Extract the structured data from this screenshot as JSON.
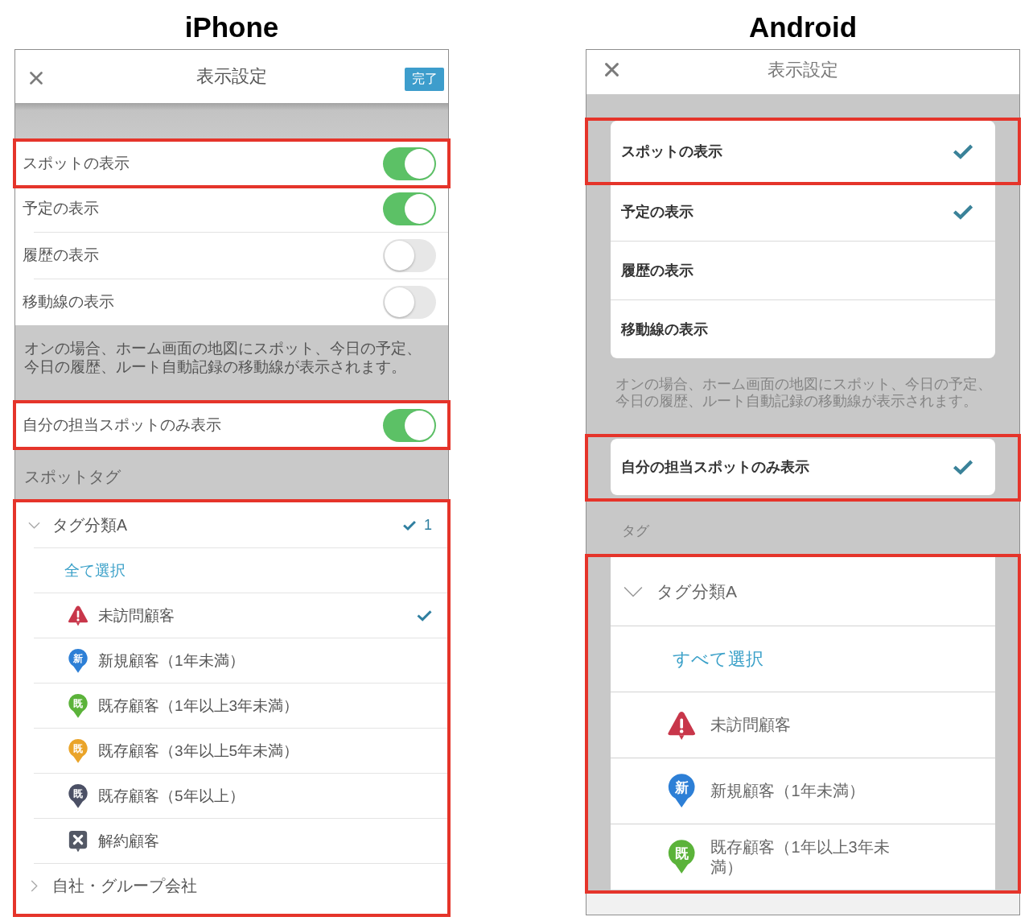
{
  "iphone": {
    "heading": "iPhone",
    "title": "表示設定",
    "done_button": "完了",
    "display_rows": [
      {
        "label": "スポットの表示",
        "on": true,
        "highlighted": true
      },
      {
        "label": "予定の表示",
        "on": true,
        "highlighted": false
      },
      {
        "label": "履歴の表示",
        "on": false,
        "highlighted": false
      },
      {
        "label": "移動線の表示",
        "on": false,
        "highlighted": false
      }
    ],
    "description": "オンの場合、ホーム画面の地図にスポット、今日の予定、今日の履歴、ルート自動記録の移動線が表示されます。",
    "own_spots_row": {
      "label": "自分の担当スポットのみ表示",
      "on": true,
      "highlighted": true
    },
    "tag_section": {
      "title": "スポットタグ",
      "highlighted": true,
      "groups": [
        {
          "label": "タグ分類A",
          "expanded": true,
          "count": "1",
          "select_all": "全て選択",
          "children": [
            {
              "label": "未訪問顧客",
              "kind": "warning",
              "color": "#c8364a",
              "checked": true
            },
            {
              "label": "新規顧客（1年未満）",
              "kind": "pin",
              "pin_text": "新",
              "color": "#2d7fd6",
              "checked": false
            },
            {
              "label": "既存顧客（1年以上3年未満）",
              "kind": "pin",
              "pin_text": "既",
              "color": "#5bb33a",
              "checked": false
            },
            {
              "label": "既存顧客（3年以上5年未満）",
              "kind": "pin",
              "pin_text": "既",
              "color": "#eaa429",
              "checked": false
            },
            {
              "label": "既存顧客（5年以上）",
              "kind": "pin",
              "pin_text": "既",
              "color": "#4b5065",
              "checked": false
            },
            {
              "label": "解約顧客",
              "kind": "cross",
              "color": "#535865",
              "checked": false
            }
          ]
        },
        {
          "label": "自社・グループ会社",
          "expanded": false
        }
      ]
    }
  },
  "android": {
    "heading": "Android",
    "title": "表示設定",
    "display_rows": [
      {
        "label": "スポットの表示",
        "checked": true,
        "highlighted": true
      },
      {
        "label": "予定の表示",
        "checked": true,
        "highlighted": false
      },
      {
        "label": "履歴の表示",
        "checked": false,
        "highlighted": false
      },
      {
        "label": "移動線の表示",
        "checked": false,
        "highlighted": false
      }
    ],
    "description": "オンの場合、ホーム画面の地図にスポット、今日の予定、今日の履歴、ルート自動記録の移動線が表示されます。",
    "own_spots_row": {
      "label": "自分の担当スポットのみ表示",
      "checked": true,
      "highlighted": true
    },
    "tag_section": {
      "title": "タグ",
      "highlighted": true,
      "groups": [
        {
          "label": "タグ分類A",
          "expanded": true,
          "select_all": "すべて選択",
          "children": [
            {
              "label": "未訪問顧客",
              "kind": "warning",
              "color": "#c8364a",
              "checked": false
            },
            {
              "label": "新規顧客（1年未満）",
              "kind": "pin",
              "pin_text": "新",
              "color": "#2d7fd6",
              "checked": false
            },
            {
              "label": "既存顧客（1年以上3年未満）",
              "kind": "pin",
              "pin_text": "既",
              "color": "#5bb33a",
              "checked": false
            }
          ]
        }
      ]
    }
  }
}
